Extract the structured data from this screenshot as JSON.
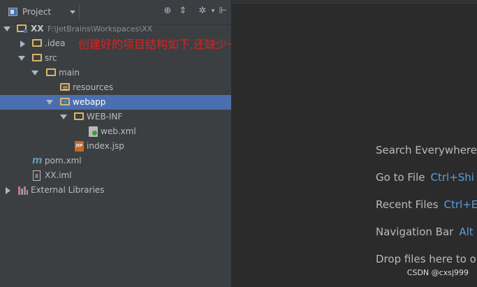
{
  "toolbar": {
    "title": "Project",
    "icons": [
      "target-icon",
      "collapse-icon",
      "gear-icon",
      "pin-icon"
    ]
  },
  "tree": {
    "root_label": "XX",
    "root_path": "F:\\JetBrains\\Workspaces\\XX",
    "idea": ".idea",
    "src": "src",
    "main": "main",
    "resources": "resources",
    "webapp": "webapp",
    "webinf": "WEB-INF",
    "webxml": "web.xml",
    "indexjsp": "index.jsp",
    "pomxml": "pom.xml",
    "xximl": "XX.iml",
    "extlibs": "External Libraries",
    "jsp_badge": "JSP"
  },
  "annotation": "创建好的项目结构如下,还缺少一些文件夹,我们手动创建",
  "hints": [
    {
      "label": "Search Everywhere",
      "key": ""
    },
    {
      "label": "Go to File",
      "key": "Ctrl+Shi"
    },
    {
      "label": "Recent Files",
      "key": "Ctrl+E"
    },
    {
      "label": "Navigation Bar",
      "key": "Alt"
    },
    {
      "label": "Drop files here to o",
      "key": ""
    }
  ],
  "watermark": "CSDN @cxsj999",
  "colors": {
    "panel_bg": "#3c3f41",
    "editor_bg": "#2b2b2b",
    "selection": "#4b6eaf",
    "folder": "#d9b66b",
    "annotation": "#e02020",
    "shortcut": "#5c9de0"
  }
}
